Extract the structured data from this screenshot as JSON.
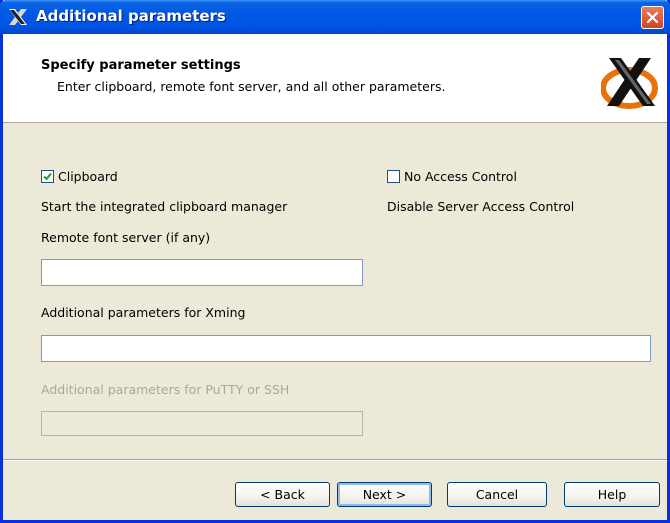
{
  "window": {
    "title": "Additional parameters",
    "icons": {
      "title": "xming-x-icon",
      "close": "close-icon",
      "logo": "xming-logo-icon"
    }
  },
  "header": {
    "title": "Specify parameter settings",
    "subtitle": "Enter clipboard, remote font server, and all other parameters."
  },
  "options": {
    "clipboard": {
      "label": "Clipboard",
      "checked": true,
      "description": "Start the integrated clipboard manager"
    },
    "no_access_control": {
      "label": "No Access Control",
      "checked": false,
      "description": "Disable Server Access Control"
    }
  },
  "fields": {
    "remote_font_server": {
      "label": "Remote font server (if any)",
      "value": ""
    },
    "xming_params": {
      "label": "Additional parameters for Xming",
      "value": ""
    },
    "putty_params": {
      "label": "Additional parameters for PuTTY or SSH",
      "value": "",
      "disabled": true
    }
  },
  "buttons": {
    "back": "< Back",
    "next": "Next >",
    "cancel": "Cancel",
    "help": "Help"
  },
  "colors": {
    "titlebar": "#0054e3",
    "face": "#ece9d8",
    "close": "#d24322",
    "logo_orange": "#e8720c"
  }
}
